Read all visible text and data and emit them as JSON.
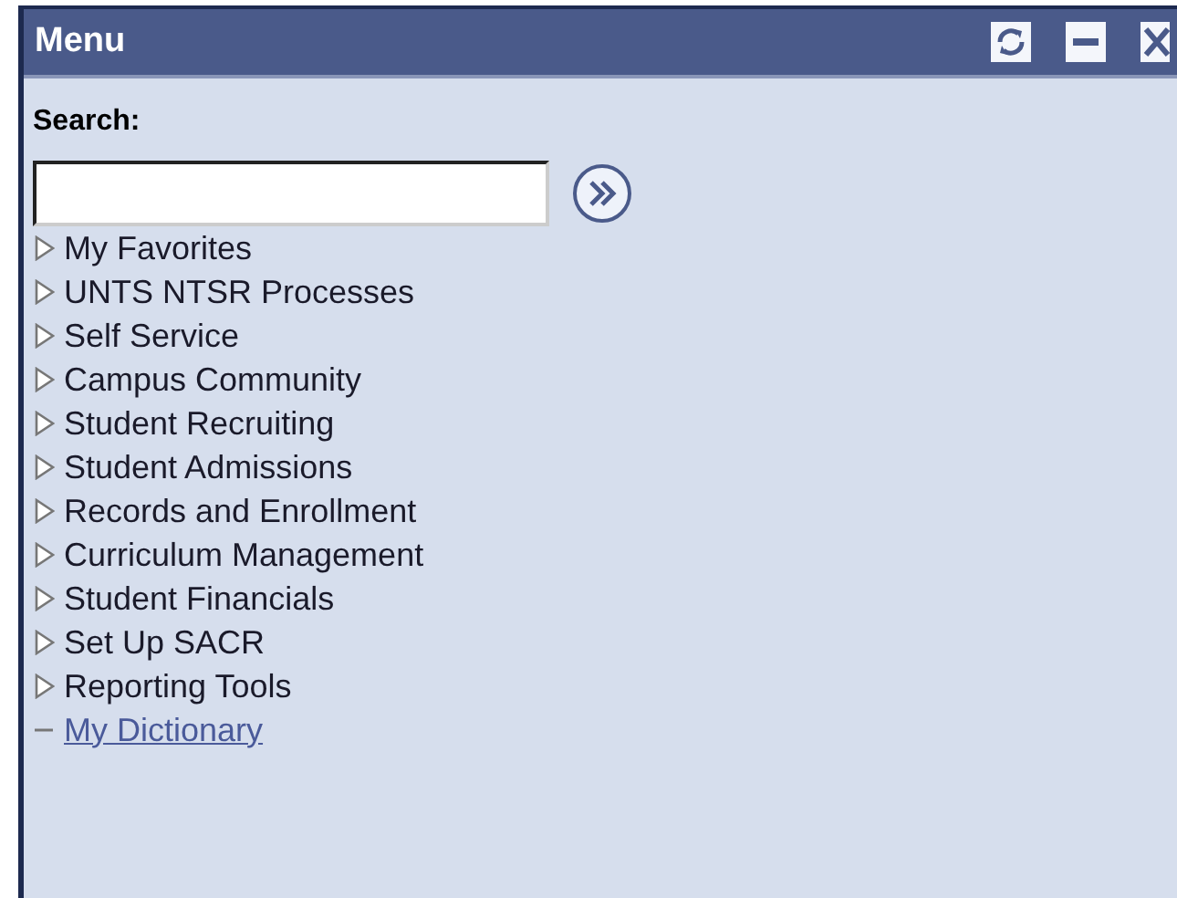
{
  "window": {
    "title": "Menu"
  },
  "search": {
    "label": "Search:"
  },
  "items": [
    {
      "kind": "folder",
      "label": "My Favorites"
    },
    {
      "kind": "folder",
      "label": "UNTS NTSR Processes"
    },
    {
      "kind": "folder",
      "label": "Self Service"
    },
    {
      "kind": "folder",
      "label": "Campus Community"
    },
    {
      "kind": "folder",
      "label": "Student Recruiting"
    },
    {
      "kind": "folder",
      "label": "Student Admissions"
    },
    {
      "kind": "folder",
      "label": "Records and Enrollment"
    },
    {
      "kind": "folder",
      "label": "Curriculum Management"
    },
    {
      "kind": "folder",
      "label": "Student Financials"
    },
    {
      "kind": "folder",
      "label": "Set Up SACR"
    },
    {
      "kind": "folder",
      "label": "Reporting Tools"
    },
    {
      "kind": "link",
      "label": "My Dictionary"
    }
  ]
}
